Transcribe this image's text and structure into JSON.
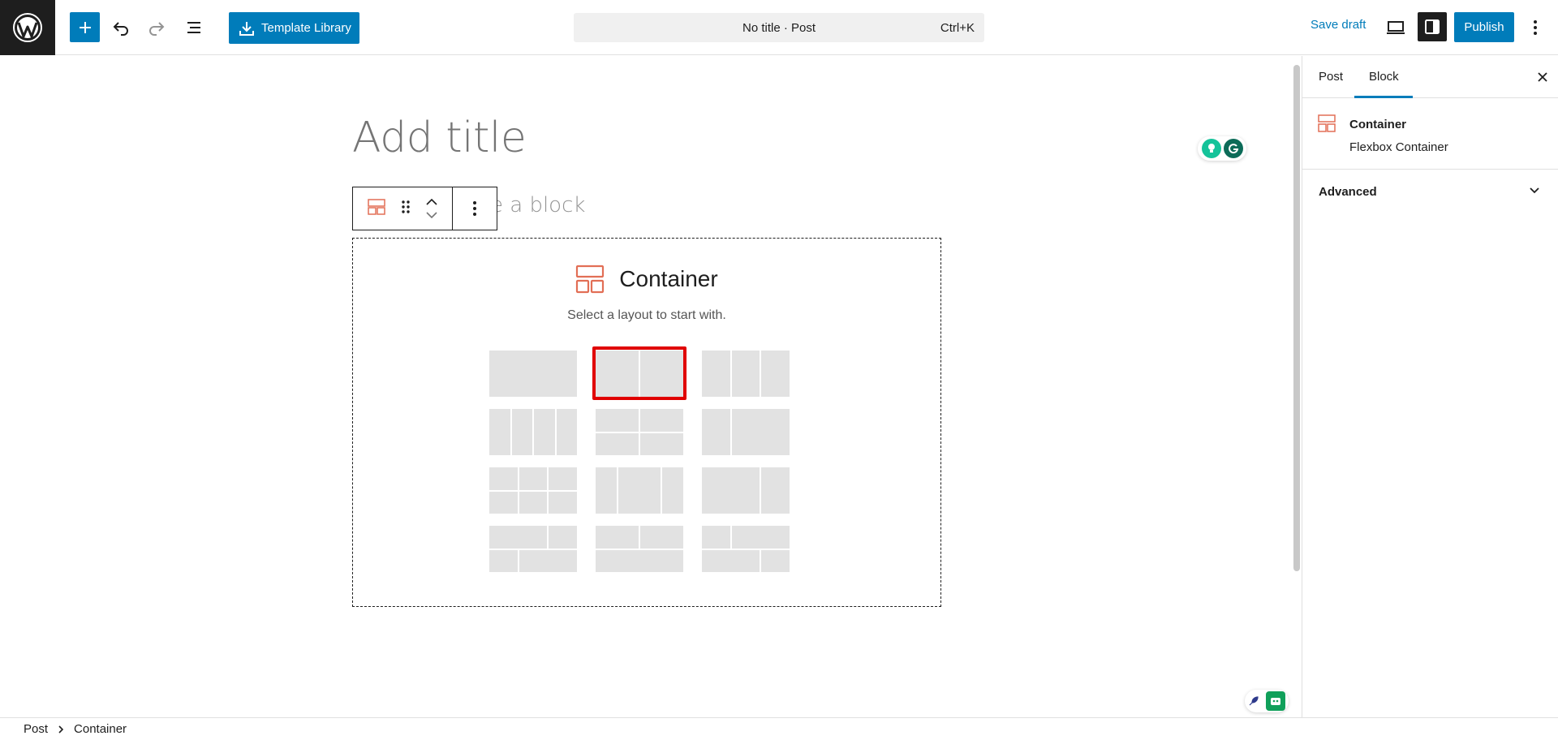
{
  "topbar": {
    "template_library_label": "Template Library",
    "document_title": "No title · Post",
    "shortcut": "Ctrl+K",
    "save_draft_label": "Save draft",
    "publish_label": "Publish"
  },
  "editor": {
    "title_placeholder": "Add title",
    "ghost_placeholder": "e a block",
    "container": {
      "title": "Container",
      "subtitle": "Select a layout to start with."
    }
  },
  "sidebar": {
    "tabs": [
      {
        "label": "Post",
        "active": false
      },
      {
        "label": "Block",
        "active": true
      }
    ],
    "block": {
      "name": "Container",
      "description": "Flexbox Container"
    },
    "panels": [
      {
        "label": "Advanced",
        "expanded": false
      }
    ]
  },
  "breadcrumb": {
    "items": [
      "Post",
      "Container"
    ]
  },
  "colors": {
    "accent": "#007cba",
    "dark": "#1e1e1e",
    "block_icon": "#e26f56",
    "highlight": "#e00000",
    "grammarly": "#15c39a"
  },
  "icons": [
    "wordpress-logo-icon",
    "plus-icon",
    "undo-icon",
    "redo-icon",
    "document-overview-icon",
    "download-icon",
    "desktop-preview-icon",
    "settings-sidebar-icon",
    "more-vertical-icon",
    "container-block-icon",
    "drag-handle-icon",
    "move-up-icon",
    "move-down-icon",
    "close-icon",
    "chevron-down-icon",
    "chevron-right-icon"
  ]
}
